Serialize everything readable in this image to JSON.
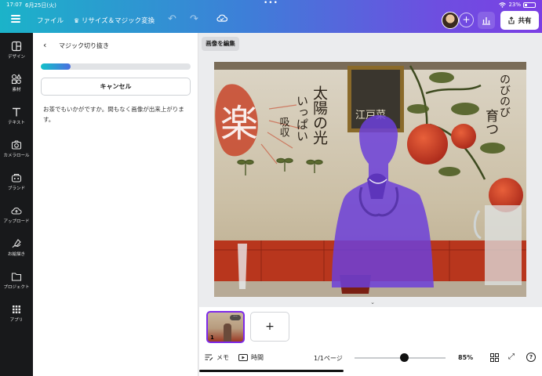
{
  "status": {
    "time": "17:07",
    "date": "6月25日(火)",
    "battery": "23%"
  },
  "toolbar": {
    "file_label": "ファイル",
    "resize_label": "リサイズ＆マジック変換",
    "share_label": "共有"
  },
  "rail": {
    "items": [
      {
        "label": "デザイン",
        "icon": "design-icon"
      },
      {
        "label": "素材",
        "icon": "elements-icon"
      },
      {
        "label": "テキスト",
        "icon": "text-icon"
      },
      {
        "label": "カメラロール",
        "icon": "camera-icon"
      },
      {
        "label": "ブランド",
        "icon": "brand-icon"
      },
      {
        "label": "アップロード",
        "icon": "upload-icon"
      },
      {
        "label": "お絵描き",
        "icon": "draw-icon"
      },
      {
        "label": "プロジェクト",
        "icon": "folder-icon"
      },
      {
        "label": "アプリ",
        "icon": "apps-icon"
      }
    ]
  },
  "panel": {
    "title": "マジック切り抜き",
    "progress": 0.2,
    "cancel_label": "キャンセル",
    "message": "お茶でもいかがですか。間もなく画像が出来上がります。"
  },
  "canvas": {
    "edit_image_label": "画像を編集",
    "mural": {
      "big_char": "楽",
      "text_sun": "太陽の光",
      "text_ippai": "いっぱい",
      "text_kyushu": "吸収",
      "text_nobinobi": "のびのび",
      "text_sodatsu": "育つ",
      "board_text": "江戸菜"
    },
    "colors": {
      "selection": "#6c3fd9",
      "accent": "#7d2ae8"
    }
  },
  "pages": {
    "current_page_number": "1"
  },
  "footer": {
    "notes_label": "メモ",
    "timer_label": "時間",
    "page_indicator": "1/1ページ",
    "zoom": "85%",
    "zoom_value": 85
  }
}
